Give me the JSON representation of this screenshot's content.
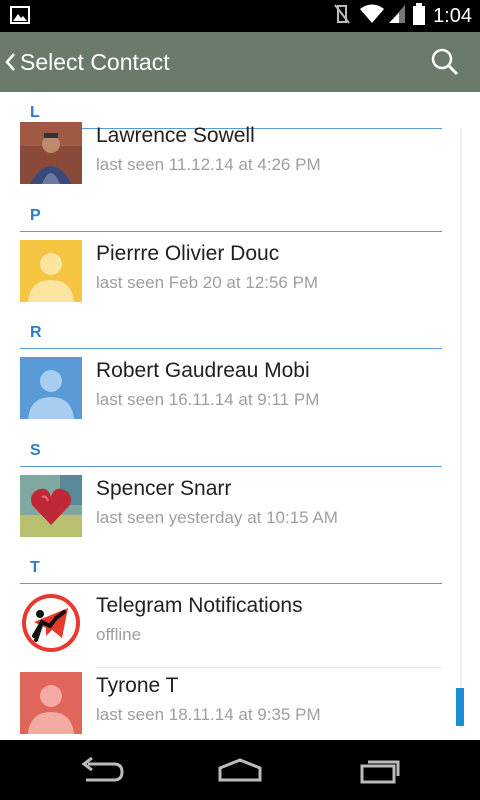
{
  "status_bar": {
    "time": "1:04"
  },
  "header": {
    "title": "Select Contact"
  },
  "sections": [
    {
      "letter": "L"
    },
    {
      "letter": "P"
    },
    {
      "letter": "R"
    },
    {
      "letter": "S"
    },
    {
      "letter": "T"
    }
  ],
  "contacts": [
    {
      "name": "Lawrence Sowell",
      "status": "last seen 11.12.14 at 4:26 PM",
      "avatar": "photo-avatar"
    },
    {
      "name": "Pierrre Olivier Douc",
      "status": "last seen Feb 20 at 12:56 PM",
      "avatar": "placeholder-avatar",
      "avatar_color": "#f5c542"
    },
    {
      "name": "Robert Gaudreau Mobi",
      "status": "last seen 16.11.14 at 9:11 PM",
      "avatar": "placeholder-avatar",
      "avatar_color": "#5a9ad6"
    },
    {
      "name": "Spencer Snarr",
      "status": "last seen yesterday at 10:15 AM",
      "avatar": "heart-avatar"
    },
    {
      "name": "Telegram Notifications",
      "status": "offline",
      "avatar": "telegram-avatar"
    },
    {
      "name": "Tyrone T",
      "status": "last seen 18.11.14 at 9:35 PM",
      "avatar": "placeholder-avatar",
      "avatar_color": "#e0655a"
    }
  ],
  "colors": {
    "action_bar": "#6b7b6b",
    "section_accent": "#2e7dc6",
    "scroll_thumb": "#1a8fd6"
  }
}
